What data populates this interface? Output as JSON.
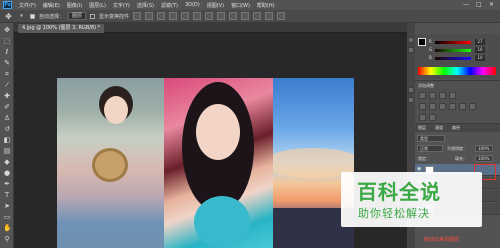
{
  "menubar": {
    "logo": "Ps",
    "items": [
      "文件(F)",
      "编辑(E)",
      "图像(I)",
      "图层(L)",
      "文字(Y)",
      "选择(S)",
      "滤镜(T)",
      "3D(D)",
      "视图(V)",
      "窗口(W)",
      "帮助(H)"
    ],
    "minimize": "—",
    "maximize": "□",
    "close": "✕"
  },
  "options": {
    "auto_select_label": "自动选择：",
    "target_value": "图层",
    "transform_label": "显示变换控件"
  },
  "document": {
    "tab_label": "4.jpg @ 100% (图层 3, RGB/8) *"
  },
  "color_panel": {
    "r_label": "R",
    "r_value": "27",
    "g_label": "G",
    "g_value": "10",
    "b_label": "B",
    "b_value": "10"
  },
  "adjustments": {
    "title": "添加调整"
  },
  "layers": {
    "tabs": [
      "图层",
      "通道",
      "路径"
    ],
    "kind_label": "类型",
    "blend_mode": "正常",
    "opacity_label": "不透明度：",
    "opacity_value": "100%",
    "fill_label": "填充：",
    "fill_value": "100%",
    "lock_label": "锁定：",
    "rows": [
      "",
      "",
      "",
      ""
    ]
  },
  "annotation": {
    "text": "拖动出来的图层"
  },
  "watermark": {
    "title": "百科全说",
    "subtitle": "助你轻松解决"
  },
  "colors": {
    "accent_red": "#e0342d",
    "watermark_green": "#39a845",
    "panel_bg": "#535353"
  }
}
